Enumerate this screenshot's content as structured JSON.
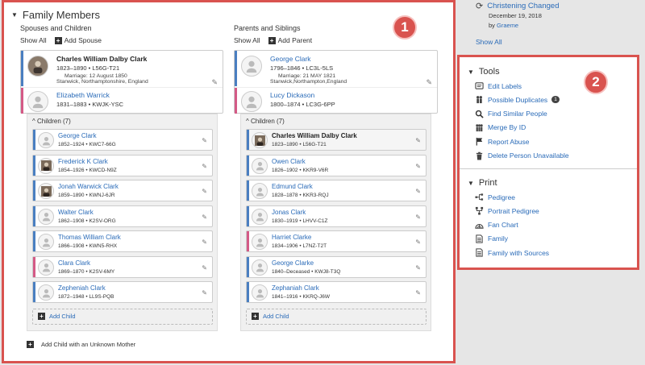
{
  "family": {
    "title": "Family Members",
    "left_col_title": "Spouses and Children",
    "right_col_title": "Parents and Siblings",
    "show_all": "Show All",
    "add_spouse": "Add Spouse",
    "add_parent": "Add Parent",
    "children_header_left": "Children (7)",
    "children_header_right": "Children (7)",
    "add_child": "Add Child",
    "add_child_unknown": "Add Child with an Unknown Mother",
    "spouse_main": {
      "name": "Charles William Dalby Clark",
      "dates": "1823–1890",
      "id": "L56G-T21",
      "marriage": "Marriage: 12 August 1850",
      "place": "Stanwick, Northamptonshire, England"
    },
    "spouse_wife": {
      "name": "Elizabeth Warrick",
      "dates": "1831–1883",
      "id": "KWJK-YSC"
    },
    "parent_father": {
      "name": "George Clark",
      "dates": "1796–1846",
      "id": "LC3L-5LS",
      "marriage": "Marriage: 21 MAY 1821",
      "place": "Stanwick,Northampton,England"
    },
    "parent_mother": {
      "name": "Lucy Dickason",
      "dates": "1800–1874",
      "id": "LC3G-6PP"
    },
    "children_left": [
      {
        "name": "George Clark",
        "dates": "1852–1924",
        "id": "KWC7-66G"
      },
      {
        "name": "Frederick K Clark",
        "dates": "1854–1926",
        "id": "KWCD-N9Z"
      },
      {
        "name": "Jonah Warwick Clark",
        "dates": "1859–1890",
        "id": "KWNJ-6JR"
      },
      {
        "name": "Walter Clark",
        "dates": "1862–1908",
        "id": "K2SV-ORG"
      },
      {
        "name": "Thomas William Clark",
        "dates": "1866–1908",
        "id": "KWN5-RHX"
      },
      {
        "name": "Clara Clark",
        "dates": "1869–1870",
        "id": "K2SV-6MY"
      },
      {
        "name": "Zepheniah Clark",
        "dates": "1872–1948",
        "id": "LL9S-PQB"
      }
    ],
    "children_right": [
      {
        "name": "Charles William Dalby Clark",
        "dates": "1823–1890",
        "id": "L56G-T21"
      },
      {
        "name": "Owen Clark",
        "dates": "1826–1902",
        "id": "KKR9-V6R"
      },
      {
        "name": "Edmund Clark",
        "dates": "1828–1878",
        "id": "KKR3-RQJ"
      },
      {
        "name": "Jonas Clark",
        "dates": "1830–1919",
        "id": "LHVV-C1Z"
      },
      {
        "name": "Harriet Clarke",
        "dates": "1834–1906",
        "id": "L7NZ-T2T"
      },
      {
        "name": "George Clarke",
        "dates": "1840–Deceased",
        "id": "KWJ8-T3Q"
      },
      {
        "name": "Zephaniah Clark",
        "dates": "1841–1916",
        "id": "KKRQ-J6W"
      }
    ]
  },
  "badges": {
    "one": "1",
    "two": "2"
  },
  "changes": {
    "item": "Christening Changed",
    "date": "December 19, 2018",
    "by_label": "by",
    "by_user": "Graeme",
    "show_all": "Show All"
  },
  "tools": {
    "title": "Tools",
    "items": [
      {
        "label": "Edit Labels",
        "icon": "label-icon"
      },
      {
        "label": "Possible Duplicates",
        "icon": "people-icon",
        "count": "1"
      },
      {
        "label": "Find Similar People",
        "icon": "search-icon"
      },
      {
        "label": "Merge By ID",
        "icon": "merge-people-icon"
      },
      {
        "label": "Report Abuse",
        "icon": "flag-icon"
      },
      {
        "label": "Delete Person Unavailable",
        "icon": "trash-icon"
      }
    ]
  },
  "print": {
    "title": "Print",
    "items": [
      {
        "label": "Pedigree",
        "icon": "pedigree-icon"
      },
      {
        "label": "Portrait Pedigree",
        "icon": "portrait-pedigree-icon"
      },
      {
        "label": "Fan Chart",
        "icon": "fan-chart-icon"
      },
      {
        "label": "Family",
        "icon": "document-icon"
      },
      {
        "label": "Family with Sources",
        "icon": "document-icon"
      }
    ]
  }
}
